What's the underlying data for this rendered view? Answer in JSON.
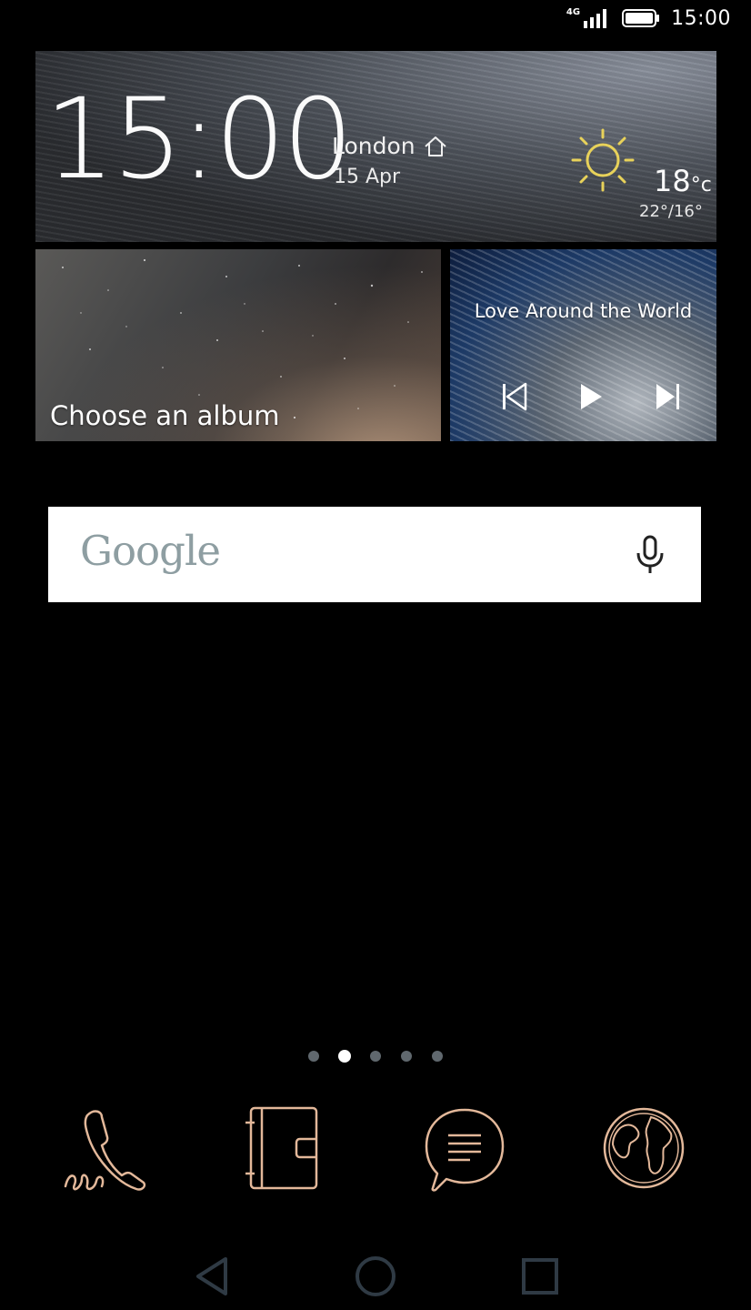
{
  "status_bar": {
    "network": "4G",
    "time": "15:00"
  },
  "weather_widget": {
    "time": "15:00",
    "city": "London",
    "date": "15 Apr",
    "condition_icon": "sun-icon",
    "temperature": "18",
    "unit": "°c",
    "range": "22°/16°"
  },
  "album_widget": {
    "label": "Choose an album"
  },
  "music_widget": {
    "title": "Love Around the World",
    "controls": [
      "previous-icon",
      "play-icon",
      "next-icon"
    ]
  },
  "search_bar": {
    "logo": "Google",
    "mic_icon": "microphone-icon"
  },
  "pager": {
    "pages": 5,
    "active_index": 1
  },
  "dock": {
    "items": [
      {
        "name": "phone",
        "icon": "phone-icon"
      },
      {
        "name": "contacts",
        "icon": "contacts-icon"
      },
      {
        "name": "messages",
        "icon": "messages-icon"
      },
      {
        "name": "browser",
        "icon": "globe-icon"
      }
    ],
    "icon_color": "#e3b89a"
  },
  "nav_bar": {
    "buttons": [
      "back-icon",
      "home-icon",
      "recents-icon"
    ]
  }
}
